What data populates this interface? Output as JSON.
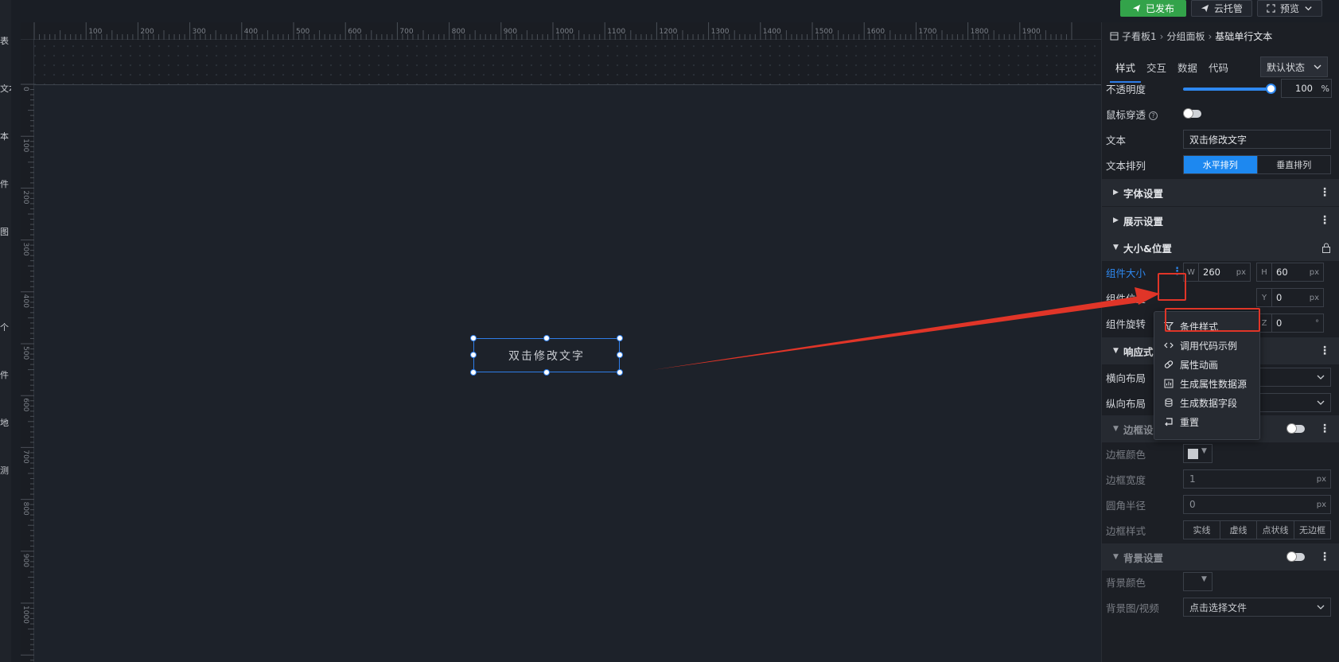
{
  "top_actions": {
    "published": "已发布",
    "cloud": "云托管",
    "preview": "预览"
  },
  "left_toolbar": [
    "表",
    "文本",
    "本",
    "件",
    "图",
    "",
    "个",
    "件",
    "地",
    "测"
  ],
  "ruler": {
    "h_ticks": [
      "100",
      "200",
      "300",
      "400",
      "500",
      "600",
      "700",
      "800",
      "900",
      "1000",
      "1100",
      "1200",
      "1300",
      "1400",
      "1500",
      "1600",
      "1700",
      "1800",
      "1900"
    ],
    "v_ticks": [
      "0",
      "100",
      "200",
      "300",
      "400",
      "500",
      "600",
      "700",
      "800",
      "900",
      "1000"
    ]
  },
  "widget": {
    "text": "双击修改文字"
  },
  "panel": {
    "breadcrumb": [
      "子看板1",
      "分组面板",
      "基础单行文本"
    ],
    "tabs": [
      "样式",
      "交互",
      "数据",
      "代码"
    ],
    "state": "默认状态",
    "opacity": {
      "label": "不透明度",
      "value": "100",
      "unit": "%",
      "level": 1.0
    },
    "mouse_through": {
      "label": "鼠标穿透"
    },
    "text": {
      "label": "文本",
      "value": "双击修改文字"
    },
    "text_direction": {
      "label": "文本排列",
      "options": [
        "水平排列",
        "垂直排列"
      ],
      "selected": 0
    },
    "font_section": "字体设置",
    "display_section": "展示设置",
    "size_section": "大小&位置",
    "size": {
      "label": "组件大小",
      "w_label": "W",
      "w": "260",
      "h_label": "H",
      "h": "60",
      "unit": "px"
    },
    "position": {
      "label": "组件位置",
      "y_label": "Y",
      "y": "0",
      "unit": "px"
    },
    "rotation": {
      "label": "组件旋转",
      "unit": "°",
      "z_label": "Z",
      "z": "0"
    },
    "responsive_section": "响应式",
    "h_layout": {
      "label": "横向布局"
    },
    "v_layout": {
      "label": "纵向布局"
    },
    "border_section": "边框设置",
    "border_color": {
      "label": "边框颜色"
    },
    "border_width": {
      "label": "边框宽度",
      "value": "1",
      "unit": "px"
    },
    "corner_radius": {
      "label": "圆角半径",
      "value": "0",
      "unit": "px"
    },
    "border_style": {
      "label": "边框样式",
      "options": [
        "实线",
        "虚线",
        "点状线",
        "无边框"
      ]
    },
    "bg_section": "背景设置",
    "bg_color": {
      "label": "背景颜色"
    },
    "bg_image": {
      "label": "背景图/视频",
      "value": "点击选择文件"
    }
  },
  "context_menu": [
    {
      "label": "条件样式",
      "icon": "filter-icon"
    },
    {
      "label": "调用代码示例",
      "icon": "code-icon"
    },
    {
      "label": "属性动画",
      "icon": "pill-icon"
    },
    {
      "label": "生成属性数据源",
      "icon": "chart-icon"
    },
    {
      "label": "生成数据字段",
      "icon": "database-icon"
    },
    {
      "label": "重置",
      "icon": "reset-icon"
    }
  ],
  "colors": {
    "accent": "#2e88f0",
    "annotation": "#e03528",
    "published": "#33a34a"
  }
}
